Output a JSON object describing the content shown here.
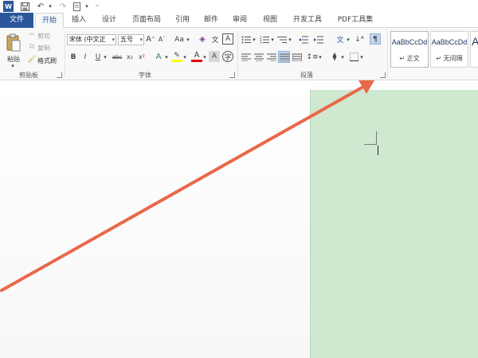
{
  "quick_access": {
    "app_icon": "word-icon",
    "save_icon": "save-icon",
    "undo_icon": "undo-icon",
    "redo_icon": "redo-icon",
    "customize_icon": "customize-icon"
  },
  "tabs": [
    {
      "label": "文件"
    },
    {
      "label": "开始"
    },
    {
      "label": "插入"
    },
    {
      "label": "设计"
    },
    {
      "label": "页面布局"
    },
    {
      "label": "引用"
    },
    {
      "label": "邮件"
    },
    {
      "label": "审阅"
    },
    {
      "label": "视图"
    },
    {
      "label": "开发工具"
    },
    {
      "label": "PDF工具集"
    }
  ],
  "clipboard": {
    "paste": "粘贴",
    "cut": "剪切",
    "copy": "复制",
    "format_painter": "格式刷",
    "group_label": "剪贴板"
  },
  "font": {
    "font_name": "宋体 (中文正",
    "font_size": "五号",
    "grow": "A",
    "shrink": "A",
    "change_case": "Aa",
    "bold": "B",
    "italic": "I",
    "underline": "U",
    "strikethrough": "abc",
    "subscript": "x₂",
    "superscript": "x²",
    "group_label": "字体"
  },
  "paragraph": {
    "group_label": "段落"
  },
  "styles": [
    {
      "sample": "AaBbCcDd",
      "name": "↵ 正文"
    },
    {
      "sample": "AaBbCcDd",
      "name": "↵ 无间隔"
    },
    {
      "sample": "A",
      "name": ""
    }
  ],
  "colors": {
    "file_tab": "#2b579a",
    "page_background": "#cfe8d0",
    "arrow": "#e9684a"
  }
}
